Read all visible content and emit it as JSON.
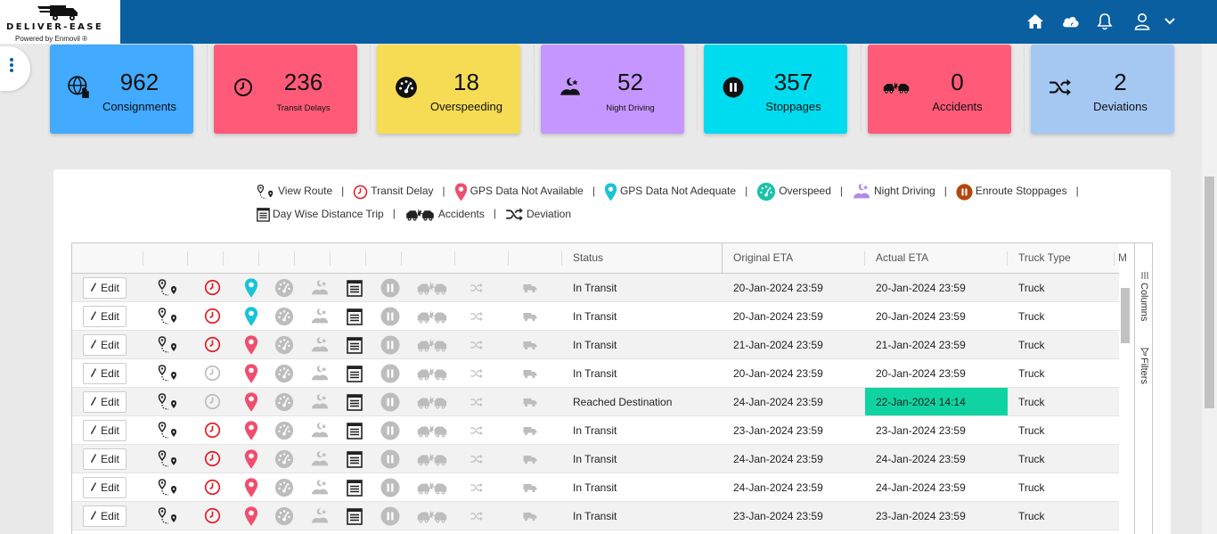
{
  "brand": {
    "name": "DELIVER-EASE",
    "powered_by": "Powered by Enmovil ®"
  },
  "header_icons": [
    "home-icon",
    "cloud-icon",
    "bell-icon",
    "user-icon",
    "chevron-down-icon"
  ],
  "cards": [
    {
      "value": "962",
      "label": "Consignments",
      "color": "#42aaff",
      "icon": "globe-hand-icon",
      "small": false
    },
    {
      "value": "236",
      "label": "Transit Delays",
      "color": "#ff5a78",
      "icon": "clock-icon",
      "small": true
    },
    {
      "value": "18",
      "label": "Overspeeding",
      "color": "#f6dc55",
      "icon": "speedometer-icon",
      "small": false
    },
    {
      "value": "52",
      "label": "Night Driving",
      "color": "#c596ff",
      "icon": "night-driving-icon",
      "small": true
    },
    {
      "value": "357",
      "label": "Stoppages",
      "color": "#00dcef",
      "icon": "pause-icon",
      "small": false
    },
    {
      "value": "0",
      "label": "Accidents",
      "color": "#ff5a78",
      "icon": "accident-icon",
      "small": false
    },
    {
      "value": "2",
      "label": "Deviations",
      "color": "#a5c8f3",
      "icon": "shuffle-icon",
      "small": false
    }
  ],
  "legend": [
    {
      "label": "View Route",
      "icon": "route-icon"
    },
    {
      "label": "Transit Delay",
      "icon": "clock-icon"
    },
    {
      "label": "GPS Data Not Available",
      "icon": "gps-pin-red-icon"
    },
    {
      "label": "GPS Data Not Adequate",
      "icon": "gps-pin-teal-icon"
    },
    {
      "label": "Overspeed",
      "icon": "speedometer-icon"
    },
    {
      "label": "Night Driving",
      "icon": "night-driving-icon"
    },
    {
      "label": "Enroute Stoppages",
      "icon": "pause-icon"
    },
    {
      "label": "Day Wise Distance Trip",
      "icon": "calendar-list-icon"
    },
    {
      "label": "Accidents",
      "icon": "accident-icon"
    },
    {
      "label": "Deviation",
      "icon": "shuffle-icon"
    }
  ],
  "grid": {
    "columns": {
      "status": "Status",
      "original_eta": "Original ETA",
      "actual_eta": "Actual ETA",
      "truck_type": "Truck Type",
      "more": "M"
    },
    "edit_label": "Edit",
    "side_tools": {
      "columns": "Columns",
      "filters": "Filters"
    },
    "rows": [
      {
        "status": "In Transit",
        "original_eta": "20-Jan-2024 23:59",
        "actual_eta": "20-Jan-2024 23:59",
        "truck_type": "Truck",
        "delay": true,
        "gps": "teal",
        "eta_highlight": false
      },
      {
        "status": "In Transit",
        "original_eta": "20-Jan-2024 23:59",
        "actual_eta": "20-Jan-2024 23:59",
        "truck_type": "Truck",
        "delay": true,
        "gps": "teal",
        "eta_highlight": false
      },
      {
        "status": "In Transit",
        "original_eta": "21-Jan-2024 23:59",
        "actual_eta": "21-Jan-2024 23:59",
        "truck_type": "Truck",
        "delay": true,
        "gps": "red",
        "eta_highlight": false
      },
      {
        "status": "In Transit",
        "original_eta": "20-Jan-2024 23:59",
        "actual_eta": "20-Jan-2024 23:59",
        "truck_type": "Truck",
        "delay": false,
        "gps": "red",
        "eta_highlight": false
      },
      {
        "status": "Reached Destination",
        "original_eta": "24-Jan-2024 23:59",
        "actual_eta": "22-Jan-2024 14:14",
        "truck_type": "Truck",
        "delay": false,
        "gps": "red",
        "eta_highlight": true
      },
      {
        "status": "In Transit",
        "original_eta": "23-Jan-2024 23:59",
        "actual_eta": "23-Jan-2024 23:59",
        "truck_type": "Truck",
        "delay": true,
        "gps": "red",
        "eta_highlight": false
      },
      {
        "status": "In Transit",
        "original_eta": "24-Jan-2024 23:59",
        "actual_eta": "24-Jan-2024 23:59",
        "truck_type": "Truck",
        "delay": true,
        "gps": "red",
        "eta_highlight": false
      },
      {
        "status": "In Transit",
        "original_eta": "24-Jan-2024 23:59",
        "actual_eta": "24-Jan-2024 23:59",
        "truck_type": "Truck",
        "delay": true,
        "gps": "red",
        "eta_highlight": false
      },
      {
        "status": "In Transit",
        "original_eta": "23-Jan-2024 23:59",
        "actual_eta": "23-Jan-2024 23:59",
        "truck_type": "Truck",
        "delay": true,
        "gps": "red",
        "eta_highlight": false
      }
    ]
  },
  "colors": {
    "header": "#0a5fa0",
    "delay_red": "#e0202a",
    "gps_red": "#f04e6e",
    "gps_teal": "#19c3d8",
    "eta_highlight": "#0fd3a0",
    "muted_icon": "#bdbdbd"
  }
}
